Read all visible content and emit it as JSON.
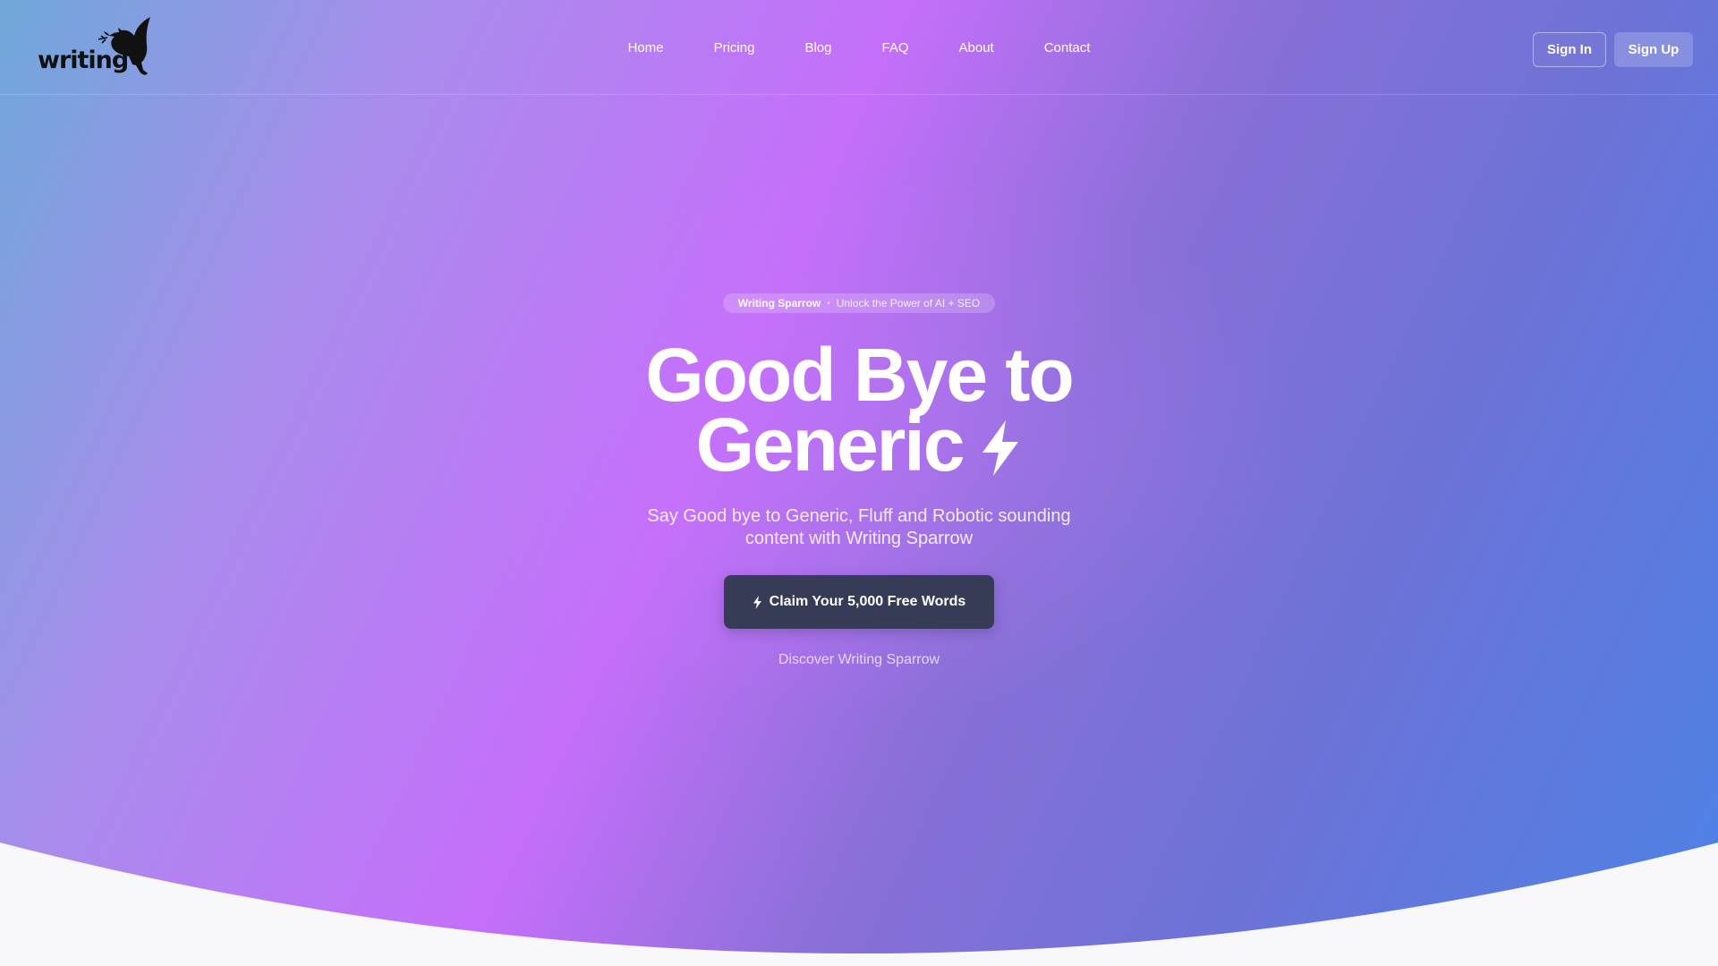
{
  "header": {
    "logo_text": "writing",
    "nav": [
      {
        "label": "Home"
      },
      {
        "label": "Pricing"
      },
      {
        "label": "Blog"
      },
      {
        "label": "FAQ"
      },
      {
        "label": "About"
      },
      {
        "label": "Contact"
      }
    ],
    "sign_in_label": "Sign In",
    "sign_up_label": "Sign Up"
  },
  "hero": {
    "badge_brand": "Writing Sparrow",
    "badge_dot": "•",
    "badge_text": "Unlock the Power of AI + SEO",
    "headline_line1": "Good Bye to",
    "headline_line2": "Generic",
    "headline_icon": "lightning-bolt-icon",
    "subtitle": "Say Good bye to Generic, Fluff and Robotic sounding content with Writing Sparrow",
    "cta_label": "Claim Your 5,000 Free Words",
    "cta_icon": "lightning-bolt-icon",
    "discover_label": "Discover Writing Sparrow"
  },
  "colors": {
    "cta_background": "#363c55",
    "gradient_start": "#6fa8da",
    "gradient_mid": "#c56ffa",
    "gradient_end": "#4d82e6",
    "footer_background": "#f8f8fb"
  }
}
